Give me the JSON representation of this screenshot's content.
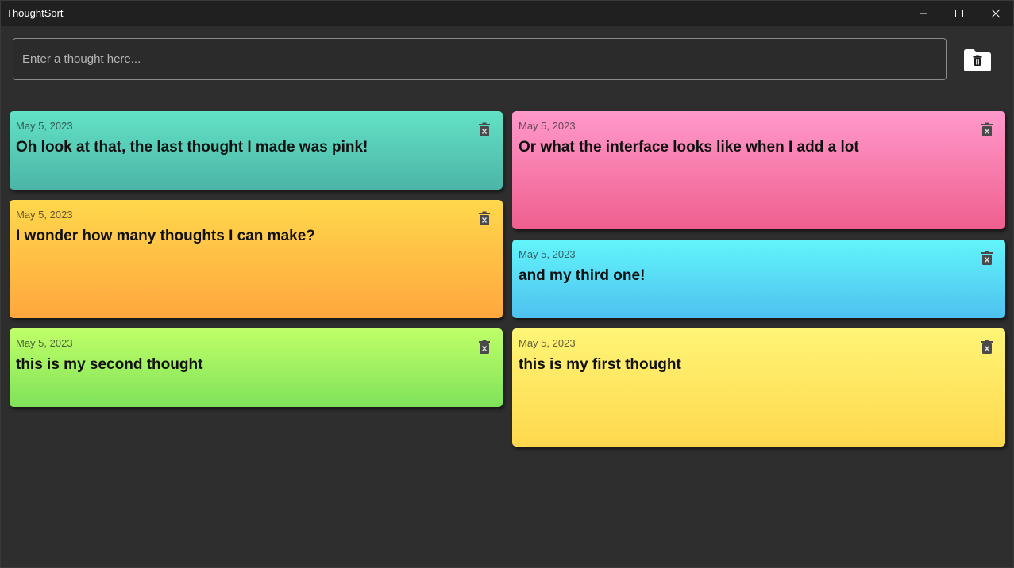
{
  "window": {
    "title": "ThoughtSort",
    "controls": [
      "minimize-icon",
      "maximize-icon",
      "close-icon"
    ]
  },
  "input": {
    "placeholder": "Enter a thought here...",
    "value": ""
  },
  "actions": {
    "clear_all_icon": "folder-trash-icon"
  },
  "thoughts": [
    {
      "date": "May 5, 2023",
      "text": "Oh look at that, the last thought I made was pink!",
      "color": "#5fd8c0"
    },
    {
      "date": "May 5, 2023",
      "text": "Or what the interface looks like when I add a lot",
      "color": "#f98cbd"
    },
    {
      "date": "May 5, 2023",
      "text": "I wonder how many thoughts I can make?",
      "color": "#ffc246"
    },
    {
      "date": "May 5, 2023",
      "text": "and my third one!",
      "color": "#59dcf6"
    },
    {
      "date": "May 5, 2023",
      "text": "this is my second thought",
      "color": "#a4f163"
    },
    {
      "date": "May 5, 2023",
      "text": "this is my first thought",
      "color": "#ffe966"
    }
  ],
  "colors": {
    "background": "#2e2e2e",
    "titlebar": "#202020",
    "input_border": "#8a8a8a",
    "delete_icon": "#4a4a4a"
  }
}
